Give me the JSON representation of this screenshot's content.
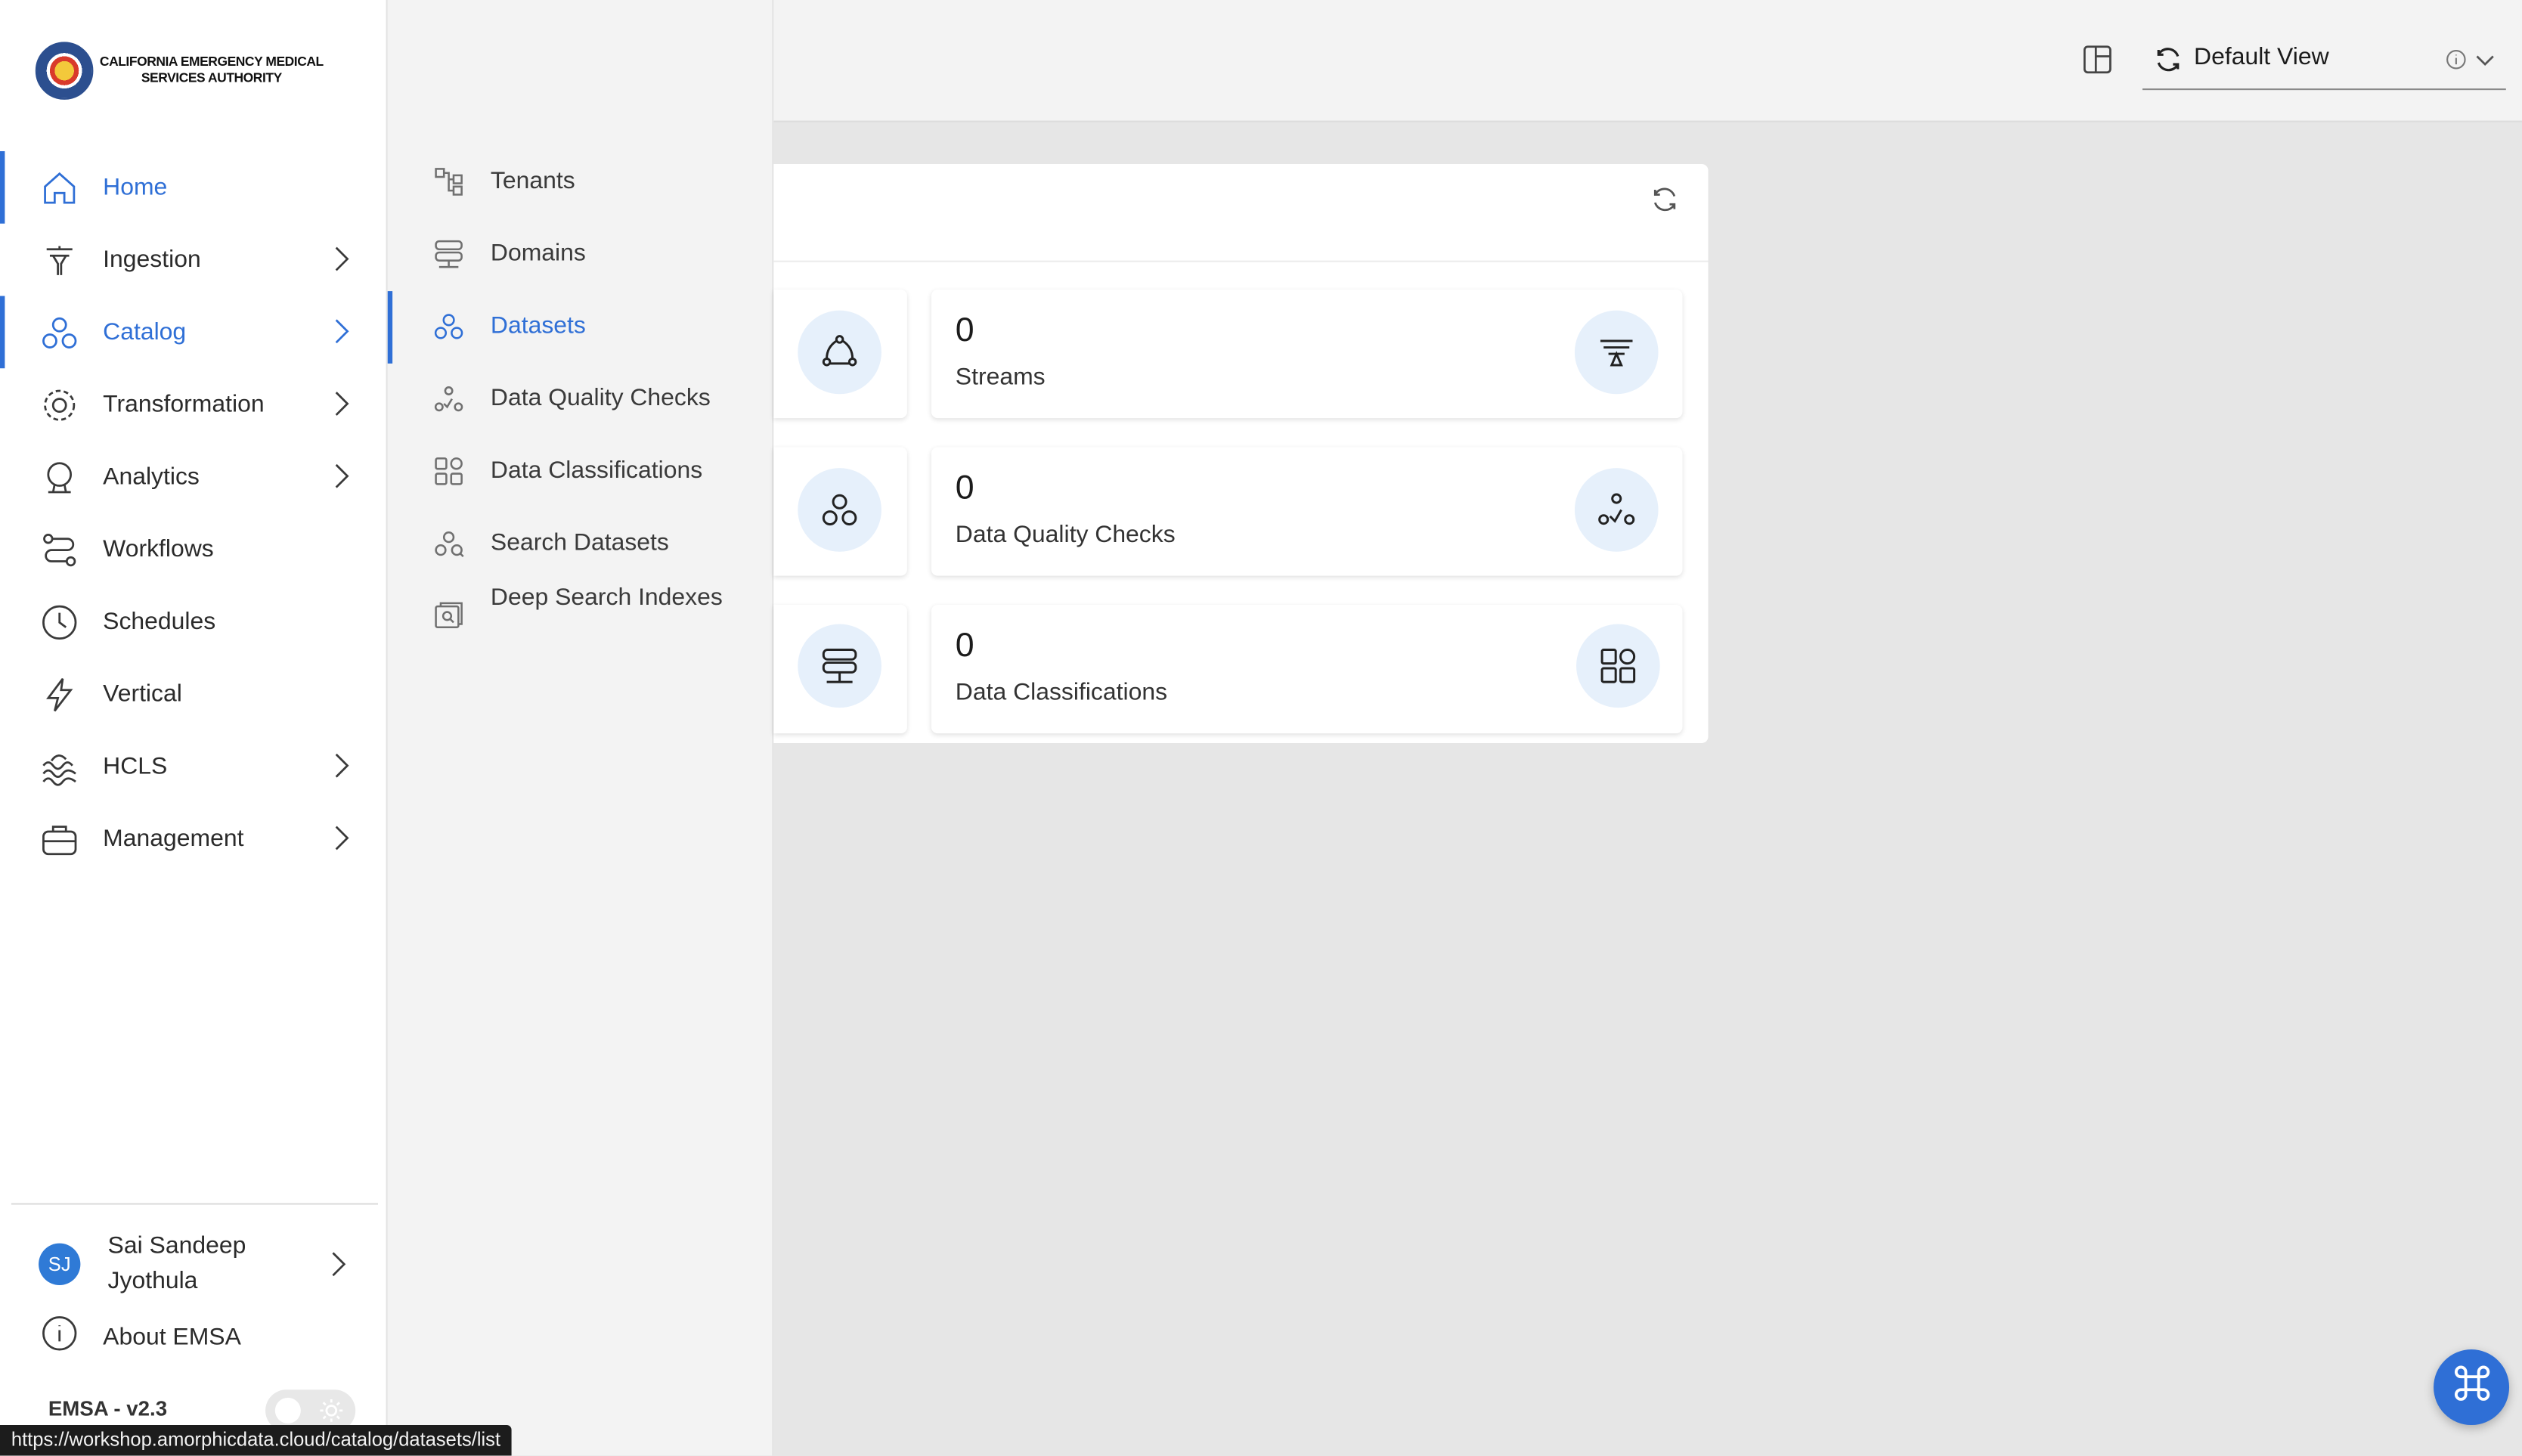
{
  "brand": {
    "org_line1": "CALIFORNIA EMERGENCY MEDICAL",
    "org_line2": "SERVICES AUTHORITY",
    "accent_color": "#2f6fd6"
  },
  "sidebar": {
    "items": [
      {
        "label": "Home",
        "icon": "home-icon",
        "active": true,
        "has_children": false
      },
      {
        "label": "Ingestion",
        "icon": "funnel-icon",
        "active": false,
        "has_children": true
      },
      {
        "label": "Catalog",
        "icon": "catalog-icon",
        "active": true,
        "has_children": true
      },
      {
        "label": "Transformation",
        "icon": "gear-icon",
        "active": false,
        "has_children": true
      },
      {
        "label": "Analytics",
        "icon": "analytics-icon",
        "active": false,
        "has_children": true
      },
      {
        "label": "Workflows",
        "icon": "workflow-icon",
        "active": false,
        "has_children": false
      },
      {
        "label": "Schedules",
        "icon": "clock-icon",
        "active": false,
        "has_children": false
      },
      {
        "label": "Vertical",
        "icon": "bolt-icon",
        "active": false,
        "has_children": false
      },
      {
        "label": "HCLS",
        "icon": "waves-icon",
        "active": false,
        "has_children": true
      },
      {
        "label": "Management",
        "icon": "briefcase-icon",
        "active": false,
        "has_children": true
      }
    ],
    "user": {
      "initials": "SJ",
      "name": "Sai Sandeep Jyothula"
    },
    "about_label": "About EMSA",
    "version": "EMSA - v2.3"
  },
  "submenu": {
    "items": [
      {
        "label": "Tenants",
        "icon": "tenants-icon",
        "active": false
      },
      {
        "label": "Domains",
        "icon": "domains-icon",
        "active": false
      },
      {
        "label": "Datasets",
        "icon": "datasets-icon",
        "active": true
      },
      {
        "label": "Data Quality Checks",
        "icon": "quality-icon",
        "active": false
      },
      {
        "label": "Data Classifications",
        "icon": "classifications-icon",
        "active": false
      },
      {
        "label": "Search Datasets",
        "icon": "search-datasets-icon",
        "active": false
      },
      {
        "label": "Deep Search Indexes",
        "icon": "deep-search-icon",
        "active": false
      }
    ]
  },
  "topbar": {
    "view_selected": "Default View"
  },
  "dashboard": {
    "tiles": [
      {
        "count": "0",
        "label": "Streams",
        "icon": "streams-icon",
        "left_icon": "cycle-icon"
      },
      {
        "count": "0",
        "label": "Data Quality Checks",
        "icon": "quality-icon",
        "left_icon": "datasets-icon"
      },
      {
        "count": "0",
        "label": "Data Classifications",
        "icon": "classifications-icon",
        "left_icon": "domains-icon"
      }
    ]
  },
  "status_url": "https://workshop.amorphicdata.cloud/catalog/datasets/list"
}
